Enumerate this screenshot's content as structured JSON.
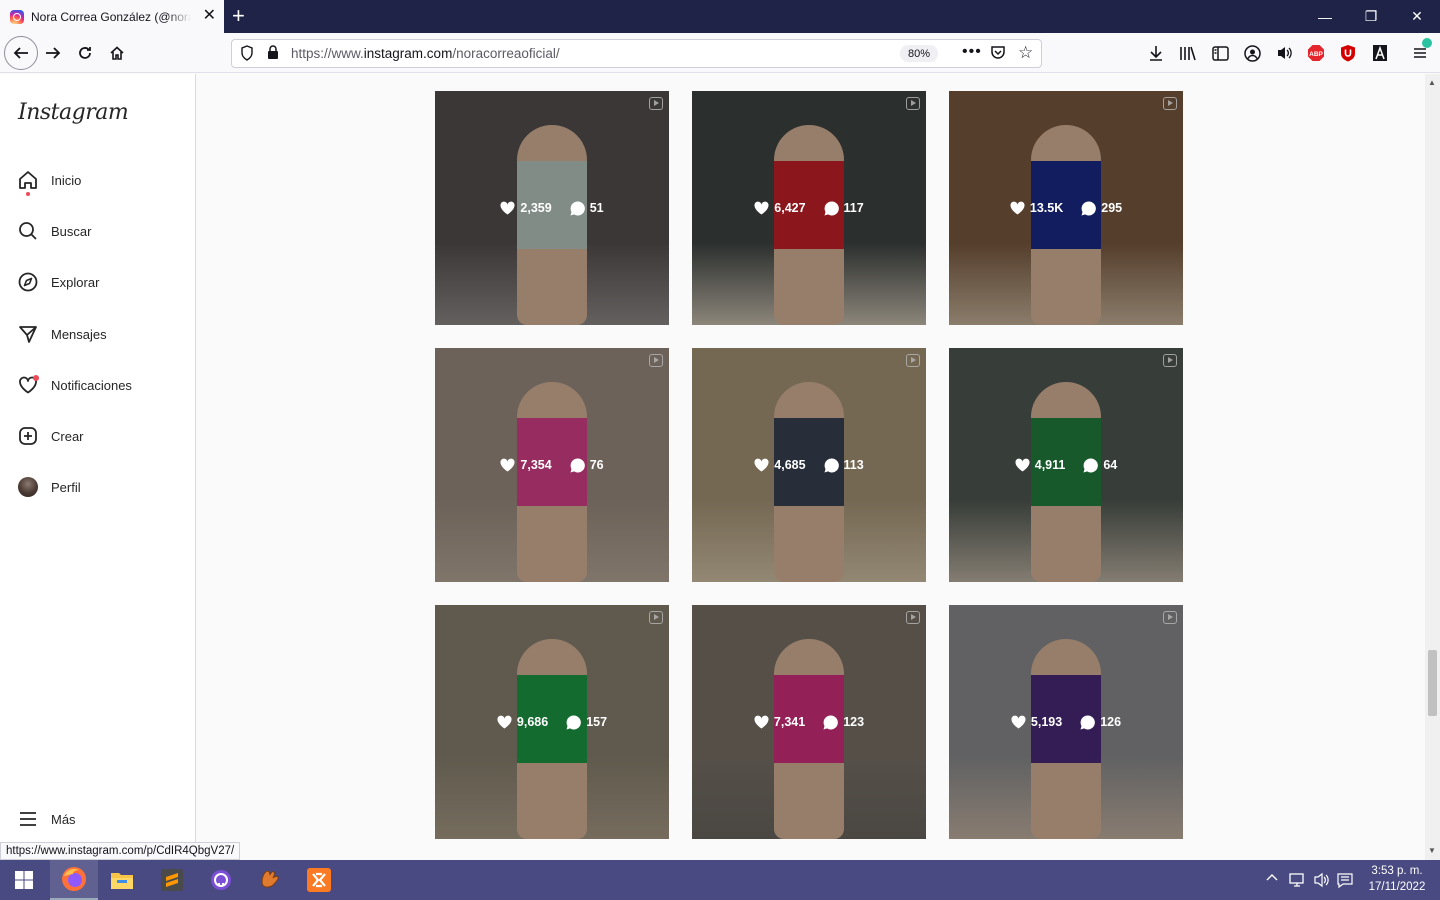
{
  "browser": {
    "tab_title": "Nora Correa González (@noracorreaoficial)",
    "url_prefix": "https://www.",
    "url_domain": "instagram.com",
    "url_path": "/noracorreaoficial/",
    "zoom": "80%",
    "status_url": "https://www.instagram.com/p/CdIR4QbgV27/"
  },
  "sidebar": {
    "logo": "Instagram",
    "items": [
      {
        "label": "Inicio",
        "icon": "home-icon"
      },
      {
        "label": "Buscar",
        "icon": "search-icon"
      },
      {
        "label": "Explorar",
        "icon": "compass-icon"
      },
      {
        "label": "Mensajes",
        "icon": "send-icon"
      },
      {
        "label": "Notificaciones",
        "icon": "heart-icon"
      },
      {
        "label": "Crear",
        "icon": "plus-square-icon"
      },
      {
        "label": "Perfil",
        "icon": "avatar"
      }
    ],
    "more_label": "Más"
  },
  "posts": [
    {
      "likes": "2,359",
      "comments": "51",
      "bg": "#55504f",
      "dress": "#b9c9c0",
      "floor": "#8f8a88"
    },
    {
      "likes": "6,427",
      "comments": "117",
      "bg": "#3e4442",
      "dress": "#c8222a",
      "floor": "#c9c0b0"
    },
    {
      "likes": "13.5K",
      "comments": "295",
      "bg": "#7a5a3f",
      "dress": "#1b2a8a",
      "floor": "#c7b39a"
    },
    {
      "likes": "7,354",
      "comments": "76",
      "bg": "#9c8d80",
      "dress": "#d7408a",
      "floor": "#b7a898"
    },
    {
      "likes": "4,685",
      "comments": "113",
      "bg": "#a89678",
      "dress": "#3a4154",
      "floor": "#d2c3a6"
    },
    {
      "likes": "4,911",
      "comments": "64",
      "bg": "#505852",
      "dress": "#22803e",
      "floor": "#bdb3a3"
    },
    {
      "likes": "9,686",
      "comments": "157",
      "bg": "#8a8270",
      "dress": "#1e9a46",
      "floor": "#a89b86"
    },
    {
      "likes": "7,341",
      "comments": "123",
      "bg": "#7a7268",
      "dress": "#d42f7e",
      "floor": "#6b6660"
    },
    {
      "likes": "5,193",
      "comments": "126",
      "bg": "#8b8c8e",
      "dress": "#4b2a7a",
      "floor": "#c4b2a2"
    }
  ],
  "taskbar": {
    "apps": [
      "windows-start-icon",
      "firefox-icon",
      "file-explorer-icon",
      "sublime-text-icon",
      "github-desktop-icon",
      "baseball-glove-icon",
      "xampp-icon"
    ],
    "time": "3:53 p. m.",
    "date": "17/11/2022"
  }
}
